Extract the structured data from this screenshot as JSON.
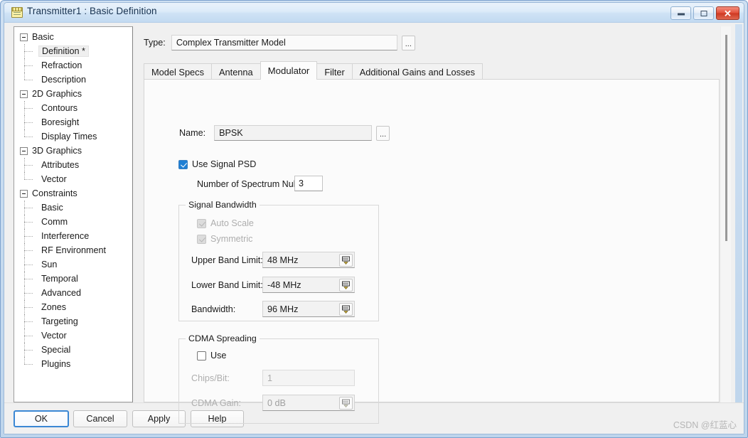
{
  "window": {
    "title": "Transmitter1 : Basic Definition",
    "icon": "notepad-icon",
    "minimize_label": "",
    "maximize_label": "",
    "close_label": "✕"
  },
  "tree": {
    "nodes": [
      {
        "label": "Basic",
        "level": "root",
        "expanded": true
      },
      {
        "label": "Definition *",
        "level": "child",
        "selected": true
      },
      {
        "label": "Refraction",
        "level": "child"
      },
      {
        "label": "Description",
        "level": "child",
        "last": true
      },
      {
        "label": "2D Graphics",
        "level": "root",
        "expanded": true
      },
      {
        "label": "Contours",
        "level": "child"
      },
      {
        "label": "Boresight",
        "level": "child"
      },
      {
        "label": "Display Times",
        "level": "child",
        "last": true
      },
      {
        "label": "3D Graphics",
        "level": "root",
        "expanded": true
      },
      {
        "label": "Attributes",
        "level": "child"
      },
      {
        "label": "Vector",
        "level": "child",
        "last": true
      },
      {
        "label": "Constraints",
        "level": "root",
        "expanded": true
      },
      {
        "label": "Basic",
        "level": "child"
      },
      {
        "label": "Comm",
        "level": "child"
      },
      {
        "label": "Interference",
        "level": "child"
      },
      {
        "label": "RF Environment",
        "level": "child"
      },
      {
        "label": "Sun",
        "level": "child"
      },
      {
        "label": "Temporal",
        "level": "child"
      },
      {
        "label": "Advanced",
        "level": "child"
      },
      {
        "label": "Zones",
        "level": "child"
      },
      {
        "label": "Targeting",
        "level": "child"
      },
      {
        "label": "Vector",
        "level": "child"
      },
      {
        "label": "Special",
        "level": "child"
      },
      {
        "label": "Plugins",
        "level": "child",
        "last": true
      }
    ]
  },
  "type_row": {
    "label": "Type:",
    "value": "Complex Transmitter Model",
    "browse_label": "..."
  },
  "tabs": [
    {
      "label": "Model Specs",
      "active": false
    },
    {
      "label": "Antenna",
      "active": false
    },
    {
      "label": "Modulator",
      "active": true
    },
    {
      "label": "Filter",
      "active": false
    },
    {
      "label": "Additional Gains and Losses",
      "active": false
    }
  ],
  "modulator": {
    "name_label": "Name:",
    "name_value": "BPSK",
    "name_browse_label": "...",
    "use_signal_psd_label": "Use Signal PSD",
    "use_signal_psd_checked": true,
    "spectrum_nulls_label": "Number of Spectrum Nulls :",
    "spectrum_nulls_value": "3",
    "signal_bandwidth": {
      "title": "Signal Bandwidth",
      "auto_scale_label": "Auto Scale",
      "auto_scale_checked": true,
      "auto_scale_disabled": true,
      "symmetric_label": "Symmetric",
      "symmetric_checked": true,
      "symmetric_disabled": true,
      "upper_band_limit_label": "Upper Band Limit:",
      "upper_band_limit_value": "48 MHz",
      "lower_band_limit_label": "Lower Band Limit:",
      "lower_band_limit_value": "-48 MHz",
      "bandwidth_label": "Bandwidth:",
      "bandwidth_value": "96 MHz"
    },
    "cdma_spreading": {
      "title": "CDMA Spreading",
      "use_label": "Use",
      "use_checked": false,
      "chips_per_bit_label": "Chips/Bit:",
      "chips_per_bit_value": "1",
      "cdma_gain_label": "CDMA Gain:",
      "cdma_gain_value": "0 dB"
    }
  },
  "footer": {
    "ok_label": "OK",
    "cancel_label": "Cancel",
    "apply_label": "Apply",
    "help_label": "Help",
    "watermark": "CSDN @红蓝心"
  },
  "colors": {
    "accent": "#1e7fd4",
    "close_button": "#cd3821",
    "focus_border": "#3a87d4"
  }
}
